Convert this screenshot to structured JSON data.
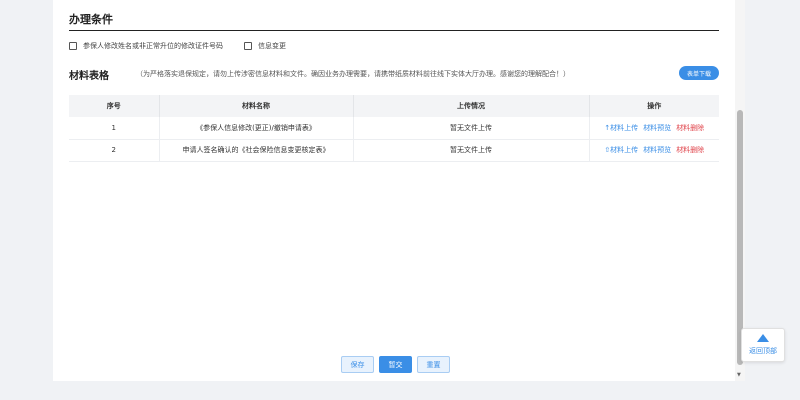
{
  "conditions": {
    "title": "办理条件",
    "items": [
      {
        "label": "参保人修改姓名或非正常升位的修改证件号码",
        "checked": false
      },
      {
        "label": "信息变更",
        "checked": false
      }
    ]
  },
  "materials": {
    "title": "材料表格",
    "note": "（为严格落实退保规定，请勿上传涉密信息材料和文件。确因业务办理需要，请携带纸质材料前往线下实体大厅办理。感谢您的理解配合！）",
    "download_label": "表单下载",
    "columns": [
      "序号",
      "材料名称",
      "上传情况",
      "操作"
    ],
    "rows": [
      {
        "index": "1",
        "name": "《参保人信息修改(更正)/撤销申请表》",
        "status": "暂无文件上传",
        "op_upload": "↑材料上传",
        "op_preview": "材料预览",
        "op_delete": "材料删除"
      },
      {
        "index": "2",
        "name": "申请人签名确认的《社会保险信息变更核定表》",
        "status": "暂无文件上传",
        "op_upload": "⇧材料上传",
        "op_preview": "材料预览",
        "op_delete": "材料删除"
      }
    ]
  },
  "actions": {
    "save": "保存",
    "submit": "暂交",
    "reset": "重置"
  },
  "back_to_top": "返回顶部",
  "colors": {
    "primary": "#3a8ee6",
    "danger": "#e0444b"
  }
}
